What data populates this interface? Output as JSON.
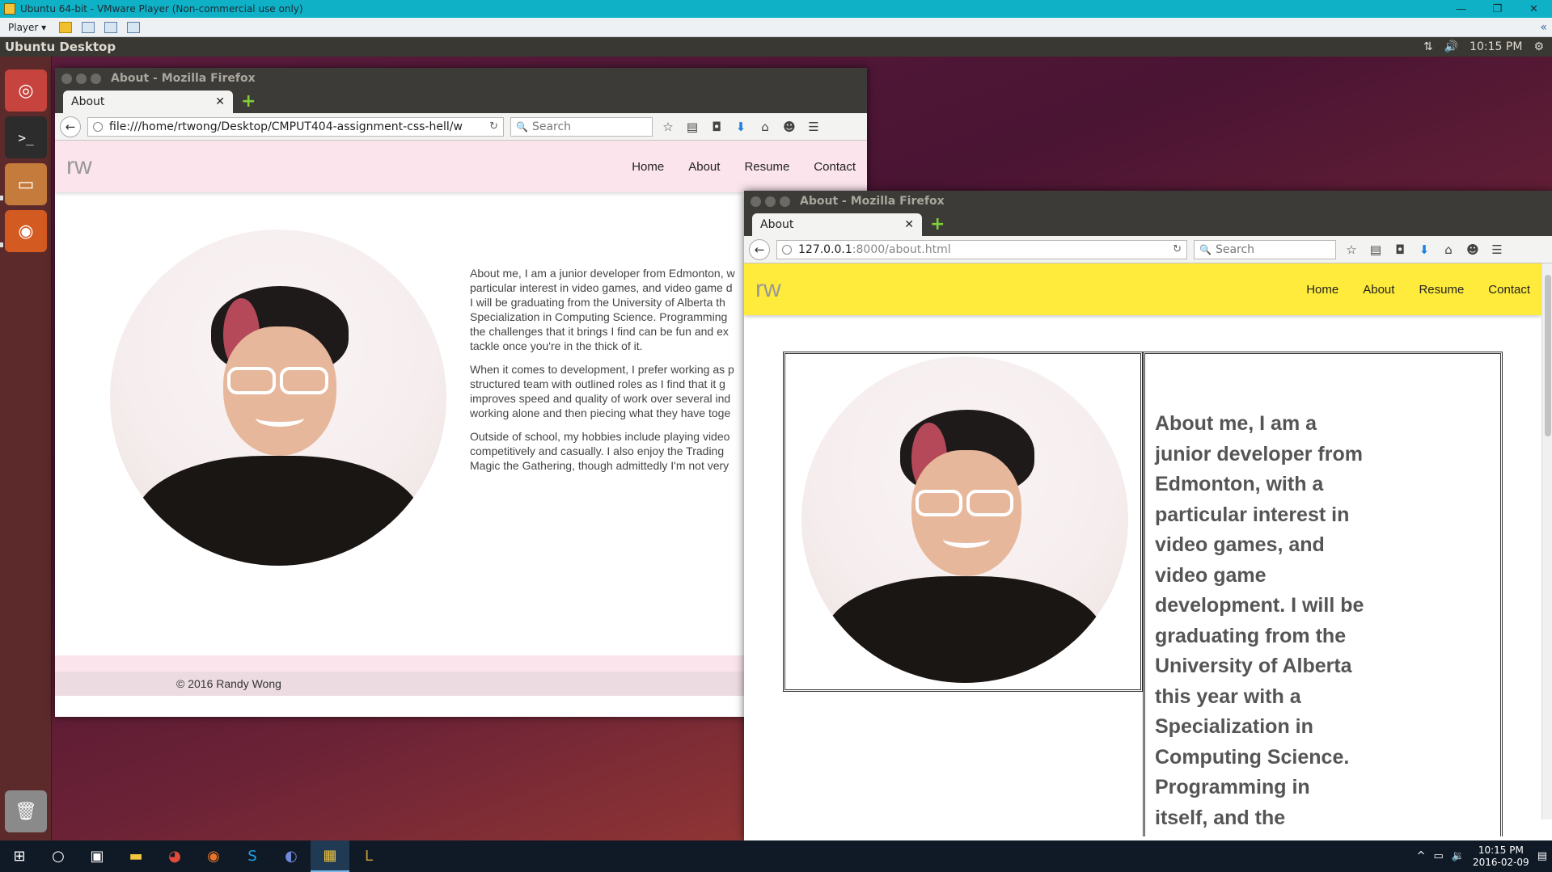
{
  "vm": {
    "title": "Ubuntu 64-bit - VMware Player (Non-commercial use only)",
    "player_menu": "Player ▾",
    "window_buttons": [
      "—",
      "❐",
      "✕"
    ]
  },
  "ubuntu_panel": {
    "title": "Ubuntu Desktop",
    "time": "10:15 PM"
  },
  "win1": {
    "title": "About - Mozilla Firefox",
    "tab_label": "About",
    "url": "file:///home/rtwong/Desktop/CMPUT404-assignment-css-hell/w",
    "search_placeholder": "Search",
    "header_bg": "#fbe4ec",
    "logo": "rw",
    "nav": [
      "Home",
      "About",
      "Resume",
      "Contact"
    ],
    "paragraphs": [
      [
        "About me, I am a junior developer from Edmonton, w",
        "particular interest in video games, and video game d",
        "I will be graduating from the University of Alberta th",
        "Specialization in Computing Science. Programming",
        "the challenges that it brings I find can be fun and ex",
        "tackle once you're in the thick of it."
      ],
      [
        "When it comes to development, I prefer working as p",
        "structured team with outlined roles as I find that it g",
        "improves speed and quality of work over several ind",
        "working alone and then piecing what they have toge"
      ],
      [
        "Outside of school, my hobbies include playing video",
        "competitively and casually. I also enjoy the Trading",
        "Magic the Gathering, though admittedly I'm not very"
      ]
    ],
    "footer": "© 2016 Randy Wong"
  },
  "win2": {
    "title": "About - Mozilla Firefox",
    "tab_label": "About",
    "url_host": "127.0.0.1",
    "url_rest": ":8000/about.html",
    "search_placeholder": "Search",
    "header_bg": "#ffeb3b",
    "logo": "rw",
    "nav": [
      "Home",
      "About",
      "Resume",
      "Contact"
    ],
    "big_text_lines": [
      "About me, I am a",
      "junior developer from",
      "Edmonton, with a",
      "particular interest in",
      "video games, and",
      "video game",
      "development. I will be",
      "graduating from the",
      "University of Alberta",
      "this year with a",
      "Specialization in",
      "Computing Science.",
      "Programming in",
      "itself, and the"
    ]
  },
  "taskbar": {
    "time": "10:15 PM",
    "date": "2016-02-09"
  }
}
